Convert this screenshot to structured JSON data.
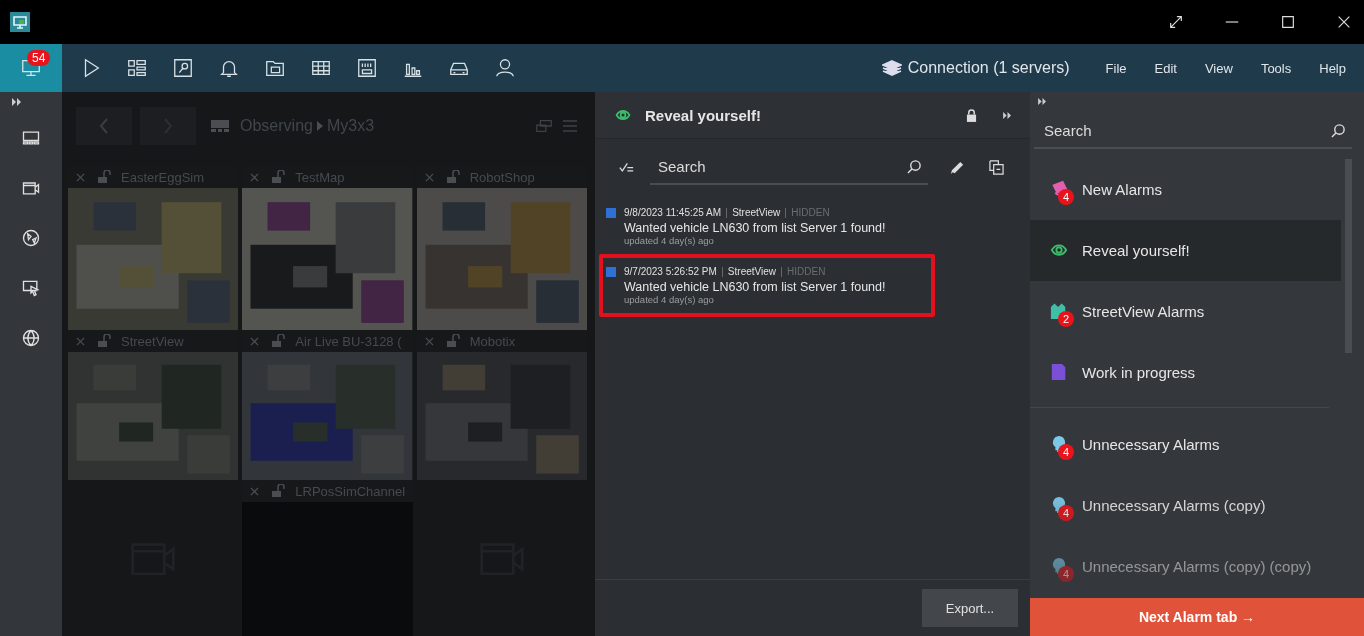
{
  "toolbar": {
    "tools": [
      {
        "selected": true,
        "badge": "54"
      },
      {
        "selected": false
      },
      {
        "selected": false
      },
      {
        "selected": false
      },
      {
        "selected": false
      },
      {
        "selected": false
      },
      {
        "selected": false
      },
      {
        "selected": false
      },
      {
        "selected": false
      },
      {
        "selected": false
      },
      {
        "selected": false
      }
    ],
    "connection": "Connection (1 servers)",
    "menu": [
      "File",
      "Edit",
      "View",
      "Tools",
      "Help"
    ]
  },
  "layout_view": {
    "breadcrumb": [
      "Observing",
      "My3x3"
    ],
    "tiles": [
      {
        "kind": "picture",
        "title": "EasterEggSim"
      },
      {
        "kind": "picture",
        "title": "TestMap"
      },
      {
        "kind": "picture",
        "title": "RobotShop"
      },
      {
        "kind": "picture",
        "title": "StreetView"
      },
      {
        "kind": "picture",
        "title": "Air Live BU-3128 ("
      },
      {
        "kind": "picture",
        "title": "Mobotix"
      },
      {
        "kind": "empty"
      },
      {
        "kind": "empty",
        "title": "LRPosSimChannel"
      },
      {
        "kind": "empty"
      }
    ]
  },
  "alarm_panel": {
    "title": "Reveal yourself!",
    "search": {
      "placeholder": "Search"
    },
    "alarms": [
      {
        "color": "#2f6fd6",
        "time": "9/8/2023 11:45:25 AM",
        "source": "StreetView",
        "status": "HIDDEN",
        "message": "Wanted vehicle LN630 from list Server 1 found!",
        "updated": "updated 4 day(s) ago",
        "highlighted": false
      },
      {
        "color": "#2f6fd6",
        "time": "9/7/2023 5:26:52 PM",
        "source": "StreetView",
        "status": "HIDDEN",
        "message": "Wanted vehicle LN630 from list Server 1 found!",
        "updated": "updated 4 day(s) ago",
        "highlighted": true
      }
    ],
    "export_button": "Export..."
  },
  "alarm_tabs": {
    "search": {
      "placeholder": "Search"
    },
    "groups": [
      [
        {
          "badge": "4",
          "label": "New Alarms",
          "selected": false
        },
        {
          "label": "Reveal yourself!",
          "selected": true
        },
        {
          "badge": "2",
          "label": "StreetView Alarms",
          "selected": false
        },
        {
          "label": "Work in progress",
          "selected": false
        }
      ],
      [
        {
          "badge": "4",
          "label": "Unnecessary Alarms",
          "selected": false
        },
        {
          "badge": "4",
          "label": "Unnecessary Alarms  (copy)",
          "selected": false
        },
        {
          "badge": "4",
          "label": "Unnecessary Alarms  (copy) (copy)",
          "selected": false
        }
      ]
    ],
    "next_button": "Next Alarm tab →"
  }
}
